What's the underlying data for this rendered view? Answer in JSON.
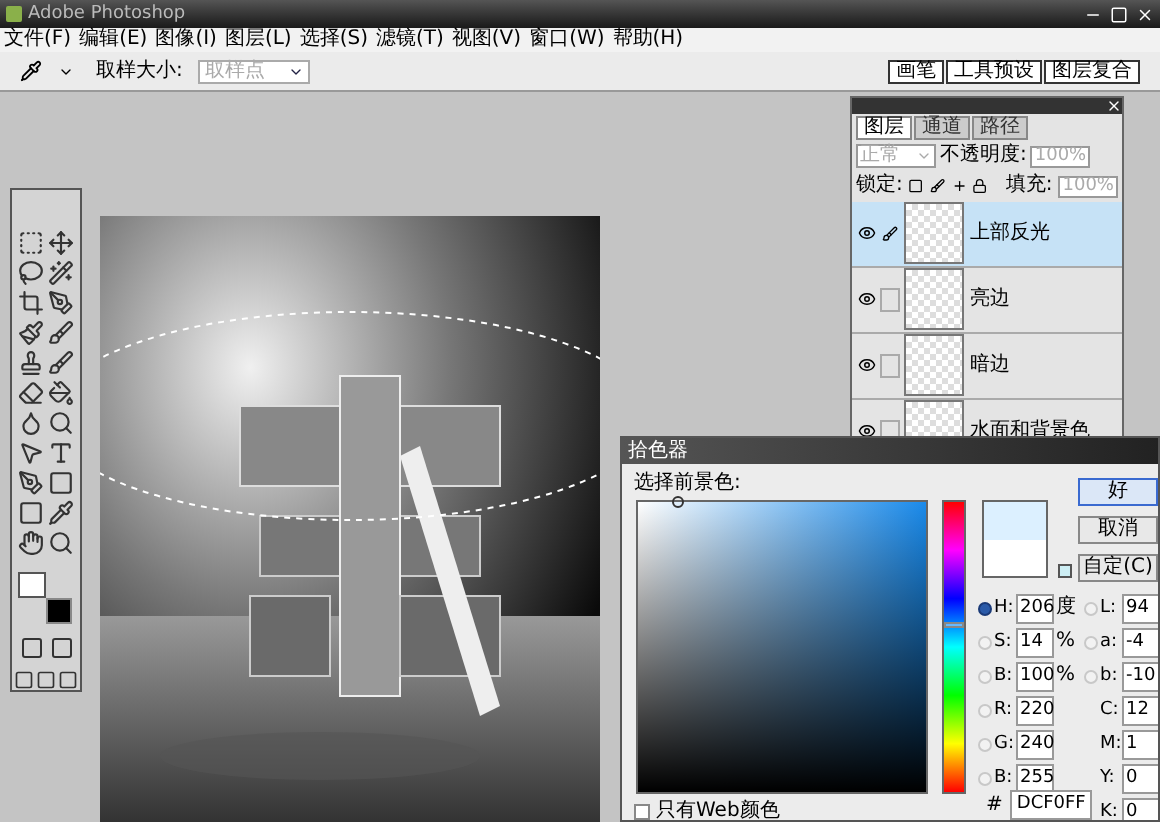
{
  "window": {
    "title": "Adobe Photoshop"
  },
  "menu": [
    "文件(F)",
    "编辑(E)",
    "图像(I)",
    "图层(L)",
    "选择(S)",
    "滤镜(T)",
    "视图(V)",
    "窗口(W)",
    "帮助(H)"
  ],
  "options_bar": {
    "sample_size_label": "取样大小:",
    "sample_size": {
      "value": "取样点",
      "disabled": true
    }
  },
  "palette_well": [
    {
      "label": "画笔"
    },
    {
      "label": "工具预设"
    },
    {
      "label": "图层复合"
    }
  ],
  "layers_panel": {
    "tabs": [
      {
        "label": "图层",
        "selected": true
      },
      {
        "label": "通道",
        "selected": false
      },
      {
        "label": "路径",
        "selected": false
      }
    ],
    "blend_mode": {
      "value": "正常",
      "disabled": true
    },
    "opacity_label": "不透明度:",
    "opacity": "100%",
    "lock_label": "锁定:",
    "fill_label": "填充:",
    "fill": "100%",
    "layers": [
      {
        "name": "上部反光",
        "selected": true,
        "linked_brush": true
      },
      {
        "name": "亮边",
        "selected": false,
        "linked_brush": false
      },
      {
        "name": "暗边",
        "selected": false,
        "linked_brush": false
      },
      {
        "name": "水面和背景色",
        "selected": false,
        "linked_brush": false
      }
    ]
  },
  "color_picker": {
    "title": "拾色器",
    "prompt": "选择前景色:",
    "hue_slider": {
      "level": 0.57
    },
    "buttons": [
      "好",
      "取消",
      "自定(C)"
    ],
    "left_fields": [
      {
        "kind": "radio",
        "label": "H:",
        "value": "206",
        "unit": "度",
        "selected": true
      },
      {
        "kind": "radio",
        "label": "S:",
        "value": "14",
        "unit": "%",
        "selected": false
      },
      {
        "kind": "radio",
        "label": "B:",
        "value": "100",
        "unit": "%",
        "selected": false
      },
      {
        "kind": "radio",
        "label": "R:",
        "value": "220",
        "selected": false
      },
      {
        "kind": "radio",
        "label": "G:",
        "value": "240",
        "selected": false
      },
      {
        "kind": "radio",
        "label": "B:",
        "value": "255",
        "selected": false
      }
    ],
    "right_fields": [
      {
        "kind": "radio",
        "label": "L:",
        "value": "94",
        "selected": false
      },
      {
        "kind": "radio",
        "label": "a:",
        "value": "-4",
        "selected": false
      },
      {
        "kind": "radio",
        "label": "b:",
        "value": "-10",
        "selected": false
      },
      {
        "kind": "plain",
        "label": "C:",
        "value": "12"
      },
      {
        "kind": "plain",
        "label": "M:",
        "value": "1"
      },
      {
        "kind": "plain",
        "label": "Y:",
        "value": "0"
      },
      {
        "kind": "plain",
        "label": "K:",
        "value": "0"
      }
    ],
    "hex_label": "#",
    "hex": "DCF0FF",
    "web_only": {
      "label": "只有Web颜色",
      "checked": false
    }
  }
}
